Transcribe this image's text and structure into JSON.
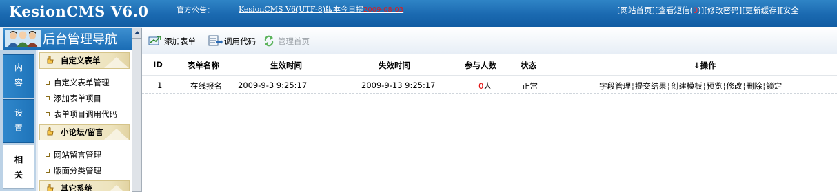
{
  "header": {
    "logo": "KesionCMS V6.0",
    "notice_label": "官方公告：",
    "notice_text": "KesionCMS V6(UTF-8)版本今日提",
    "notice_date": "2009-08-03",
    "links": {
      "home": "[网站首页]",
      "msg_prefix": "[查看短信(",
      "msg_count": "0",
      "msg_suffix": ")]",
      "password": "[修改密码]",
      "cache": "[更新缓存]",
      "safe": "[安全"
    }
  },
  "sidebar": {
    "title": "后台管理导航",
    "tabs": [
      {
        "c1": "内",
        "c2": "容"
      },
      {
        "c1": "设",
        "c2": "置"
      },
      {
        "c1": "相",
        "c2": "关"
      }
    ],
    "groups": [
      {
        "title": "自定义表单",
        "items": [
          "自定义表单管理",
          "添加表单项目",
          "表单项目调用代码"
        ]
      },
      {
        "title": "小论坛/留言",
        "items": [
          "网站留言管理",
          "版面分类管理"
        ]
      },
      {
        "title": "其它系统",
        "items": []
      }
    ]
  },
  "toolbar": {
    "add": "添加表单",
    "code": "调用代码",
    "home": "管理首页"
  },
  "table": {
    "headers": {
      "id": "ID",
      "name": "表单名称",
      "start": "生效时间",
      "end": "失效时间",
      "count": "参与人数",
      "status": "状态",
      "ops": "↓操作"
    },
    "rows": [
      {
        "id": "1",
        "name": "在线报名",
        "start": "2009-9-3 9:25:17",
        "end": "2009-9-13 9:25:17",
        "count": "0",
        "count_unit": "人",
        "status": "正常",
        "ops": [
          "字段管理",
          "提交结果",
          "创建模板",
          "预览",
          "修改",
          "删除",
          "锁定"
        ],
        "sep": "¦"
      }
    ]
  },
  "colors": {
    "header_blue": "#1a69b0",
    "accent_red": "#e00000",
    "group_bg": "#ede3bd"
  }
}
